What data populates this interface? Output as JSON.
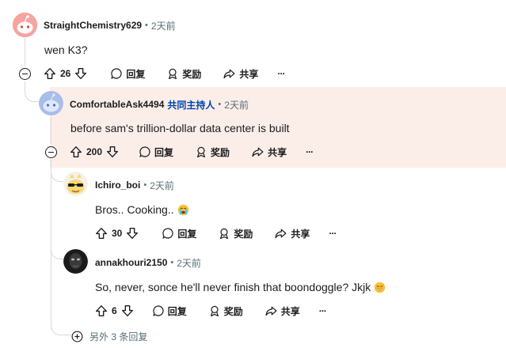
{
  "comments": [
    {
      "author": "StraightChemistry629",
      "mod_badge": "",
      "time": "2天前",
      "text": "wen K3?",
      "score": "26",
      "reply_label": "回复",
      "award_label": "奖励",
      "share_label": "共享",
      "more_label": "···"
    },
    {
      "author": "ComfortableAsk4494",
      "mod_badge": "共同主持人",
      "time": "2天前",
      "text": "before sam's trillion-dollar data center is built",
      "score": "200",
      "reply_label": "回复",
      "award_label": "奖励",
      "share_label": "共享",
      "more_label": "···"
    },
    {
      "author": "Ichiro_boi",
      "mod_badge": "",
      "time": "2天前",
      "text": "Bros.. Cooking..",
      "emoji": "crying-face-emoji",
      "score": "30",
      "reply_label": "回复",
      "award_label": "奖励",
      "share_label": "共享",
      "more_label": "···"
    },
    {
      "author": "annakhouri2150",
      "mod_badge": "",
      "time": "2天前",
      "text": "So, never, sonce he'll never finish that boondoggle? Jkjk",
      "emoji": "sweat-smile-emoji",
      "score": "6",
      "reply_label": "回复",
      "award_label": "奖励",
      "share_label": "共享",
      "more_label": "···"
    }
  ],
  "more_replies": "另外 3 条回复",
  "separator": "•",
  "colors": {
    "highlight_bg": "#fbeee9",
    "mod_blue": "#0045ac",
    "thread_line": "#d7dadc",
    "meta_gray": "#576f76"
  }
}
